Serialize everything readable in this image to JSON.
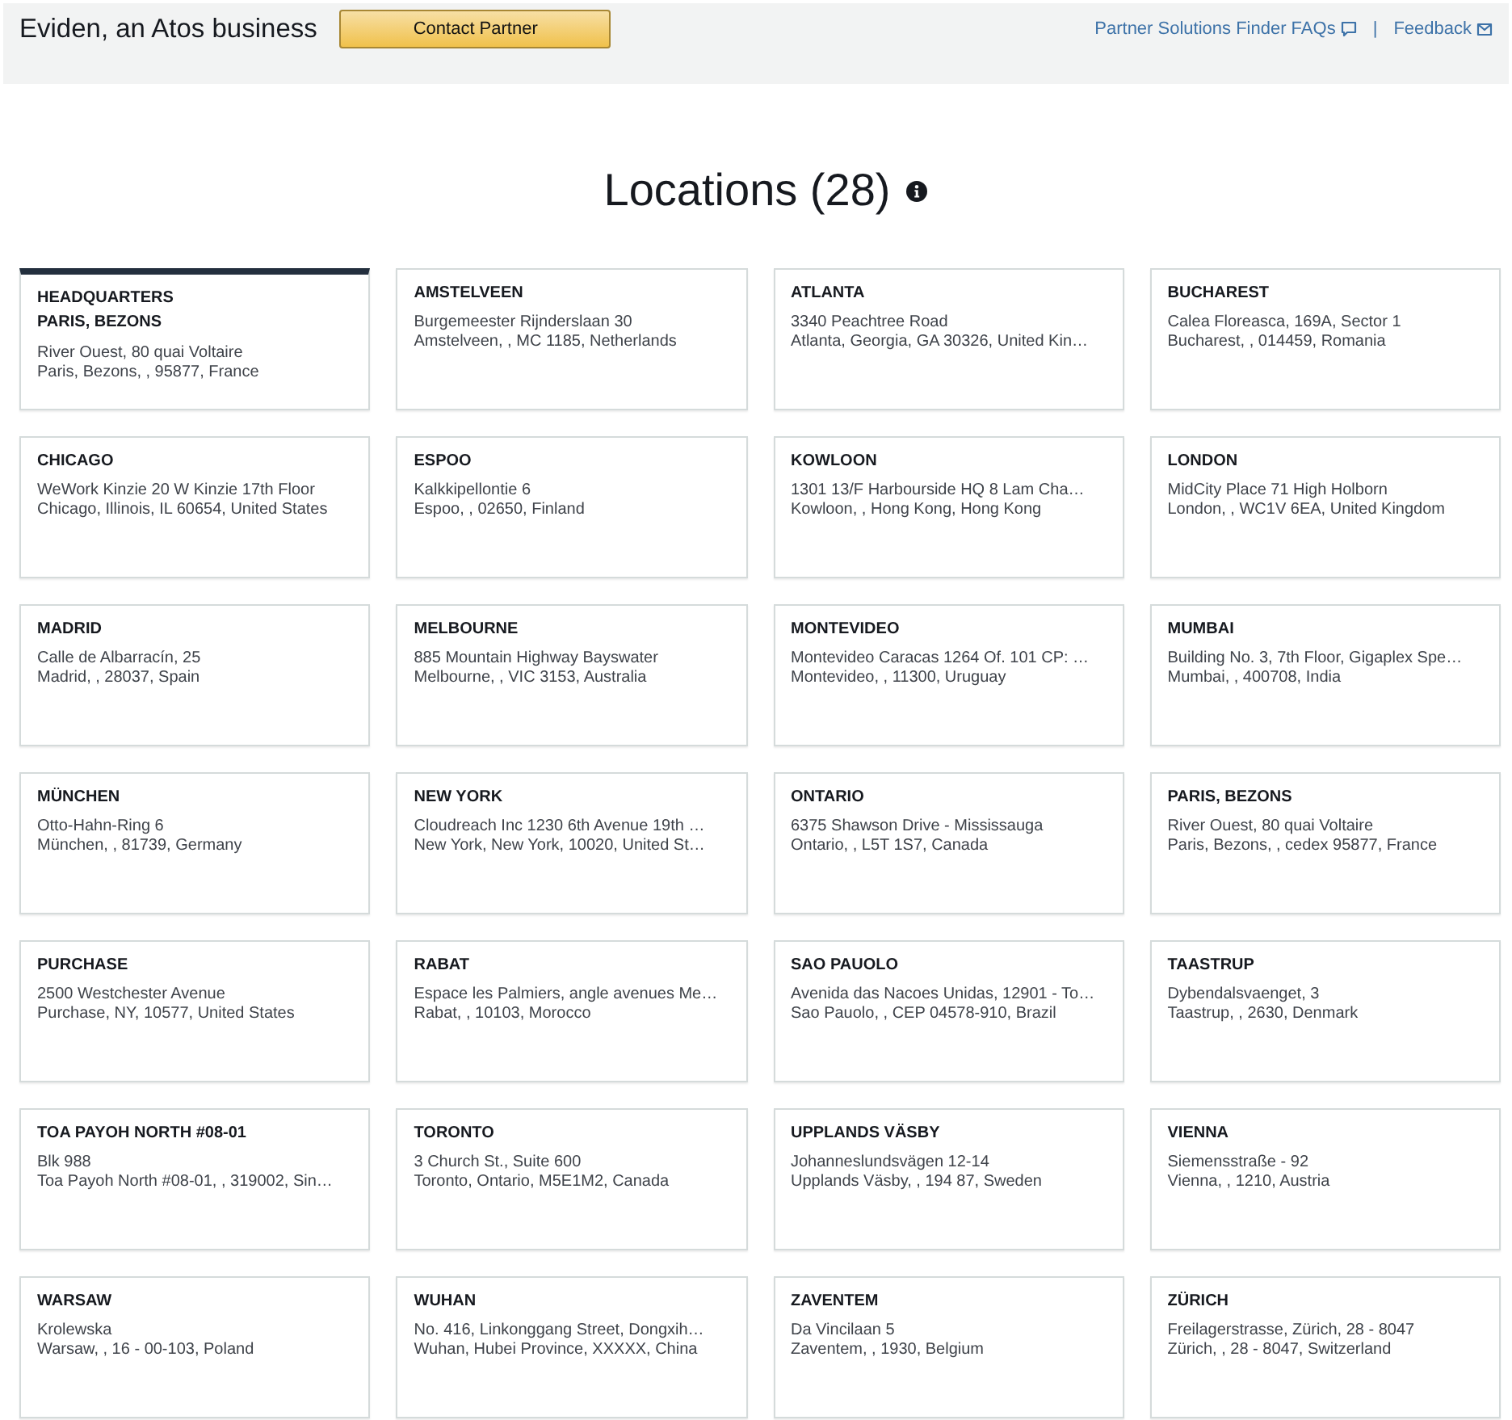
{
  "header": {
    "company": "Eviden, an Atos business",
    "contact_button": "Contact Partner",
    "links": [
      {
        "label": "Partner Solutions Finder FAQs",
        "kind": "faq"
      },
      {
        "label": "Feedback",
        "kind": "feedback"
      }
    ],
    "separator": "|"
  },
  "title": "Locations (28)",
  "locations": [
    {
      "badge": "HEADQUARTERS",
      "name": "PARIS, BEZONS",
      "lines": [
        "River Ouest, 80 quai Voltaire",
        "Paris, Bezons, , 95877, France"
      ],
      "selected": true
    },
    {
      "name": "AMSTELVEEN",
      "lines": [
        "Burgemeester Rijnderslaan 30",
        "Amstelveen, , MC 1185, Netherlands"
      ],
      "selected": false
    },
    {
      "name": "ATLANTA",
      "lines": [
        "3340 Peachtree Road",
        "Atlanta, Georgia, GA 30326, United Kin…"
      ],
      "selected": false
    },
    {
      "name": "BUCHAREST",
      "lines": [
        "Calea Floreasca, 169A, Sector 1",
        "Bucharest, , 014459, Romania"
      ],
      "selected": false
    },
    {
      "name": "CHICAGO",
      "lines": [
        "WeWork Kinzie 20 W Kinzie 17th Floor",
        "Chicago, Illinois, IL 60654, United States"
      ],
      "selected": false
    },
    {
      "name": "ESPOO",
      "lines": [
        "Kalkkipellontie 6",
        "Espoo, , 02650, Finland"
      ],
      "selected": false
    },
    {
      "name": "KOWLOON",
      "lines": [
        "1301 13/F Harbourside HQ 8 Lam Cha…",
        "Kowloon, , Hong Kong, Hong Kong"
      ],
      "selected": false
    },
    {
      "name": "LONDON",
      "lines": [
        "MidCity Place 71 High Holborn",
        "London, , WC1V 6EA, United Kingdom"
      ],
      "selected": false
    },
    {
      "name": "MADRID",
      "lines": [
        "Calle de Albarracín, 25",
        "Madrid, , 28037, Spain"
      ],
      "selected": false
    },
    {
      "name": "MELBOURNE",
      "lines": [
        "885 Mountain Highway Bayswater",
        "Melbourne, , VIC 3153, Australia"
      ],
      "selected": false
    },
    {
      "name": "MONTEVIDEO",
      "lines": [
        "Montevideo Caracas 1264 Of. 101 CP: …",
        "Montevideo, , 11300, Uruguay"
      ],
      "selected": false
    },
    {
      "name": "MUMBAI",
      "lines": [
        "Building No. 3, 7th Floor, Gigaplex Spe…",
        "Mumbai, , 400708, India"
      ],
      "selected": false
    },
    {
      "name": "MÜNCHEN",
      "lines": [
        "Otto-Hahn-Ring 6",
        "München, , 81739, Germany"
      ],
      "selected": false
    },
    {
      "name": "NEW YORK",
      "lines": [
        "Cloudreach Inc 1230 6th Avenue 19th …",
        "New York, New York, 10020, United St…"
      ],
      "selected": false
    },
    {
      "name": "ONTARIO",
      "lines": [
        "6375 Shawson Drive - Mississauga",
        "Ontario, , L5T 1S7, Canada"
      ],
      "selected": false
    },
    {
      "name": "PARIS, BEZONS",
      "lines": [
        "River Ouest, 80 quai Voltaire",
        "Paris, Bezons, , cedex 95877, France"
      ],
      "selected": false
    },
    {
      "name": "PURCHASE",
      "lines": [
        "2500 Westchester Avenue",
        "Purchase, NY, 10577, United States"
      ],
      "selected": false
    },
    {
      "name": "RABAT",
      "lines": [
        "Espace les Palmiers, angle avenues Me…",
        "Rabat, , 10103, Morocco"
      ],
      "selected": false
    },
    {
      "name": "SAO PAUOLO",
      "lines": [
        "Avenida das Nacoes Unidas, 12901 - To…",
        "Sao Pauolo, , CEP 04578-910, Brazil"
      ],
      "selected": false
    },
    {
      "name": "TAASTRUP",
      "lines": [
        "Dybendalsvaenget, 3",
        "Taastrup, , 2630, Denmark"
      ],
      "selected": false
    },
    {
      "name": "TOA PAYOH NORTH #08-01",
      "lines": [
        "Blk 988",
        "Toa Payoh North #08-01, , 319002, Sin…"
      ],
      "selected": false
    },
    {
      "name": "TORONTO",
      "lines": [
        "3 Church St., Suite 600",
        "Toronto, Ontario, M5E1M2, Canada"
      ],
      "selected": false
    },
    {
      "name": "UPPLANDS VÄSBY",
      "lines": [
        "Johanneslundsvägen 12-14",
        "Upplands Väsby, , 194 87, Sweden"
      ],
      "selected": false
    },
    {
      "name": "VIENNA",
      "lines": [
        "Siemensstraße - 92",
        "Vienna, , 1210, Austria"
      ],
      "selected": false
    },
    {
      "name": "WARSAW",
      "lines": [
        "Krolewska",
        "Warsaw, , 16 - 00-103, Poland"
      ],
      "selected": false
    },
    {
      "name": "WUHAN",
      "lines": [
        "No. 416, Linkonggang Street, Dongxih…",
        "Wuhan, Hubei Province, XXXXX, China"
      ],
      "selected": false
    },
    {
      "name": "ZAVENTEM",
      "lines": [
        "Da Vincilaan 5",
        "Zaventem, , 1930, Belgium"
      ],
      "selected": false
    },
    {
      "name": "ZÜRICH",
      "lines": [
        "Freilagerstrasse, Zürich, 28 - 8047",
        "Zürich, , 28 - 8047, Switzerland"
      ],
      "selected": false
    }
  ]
}
